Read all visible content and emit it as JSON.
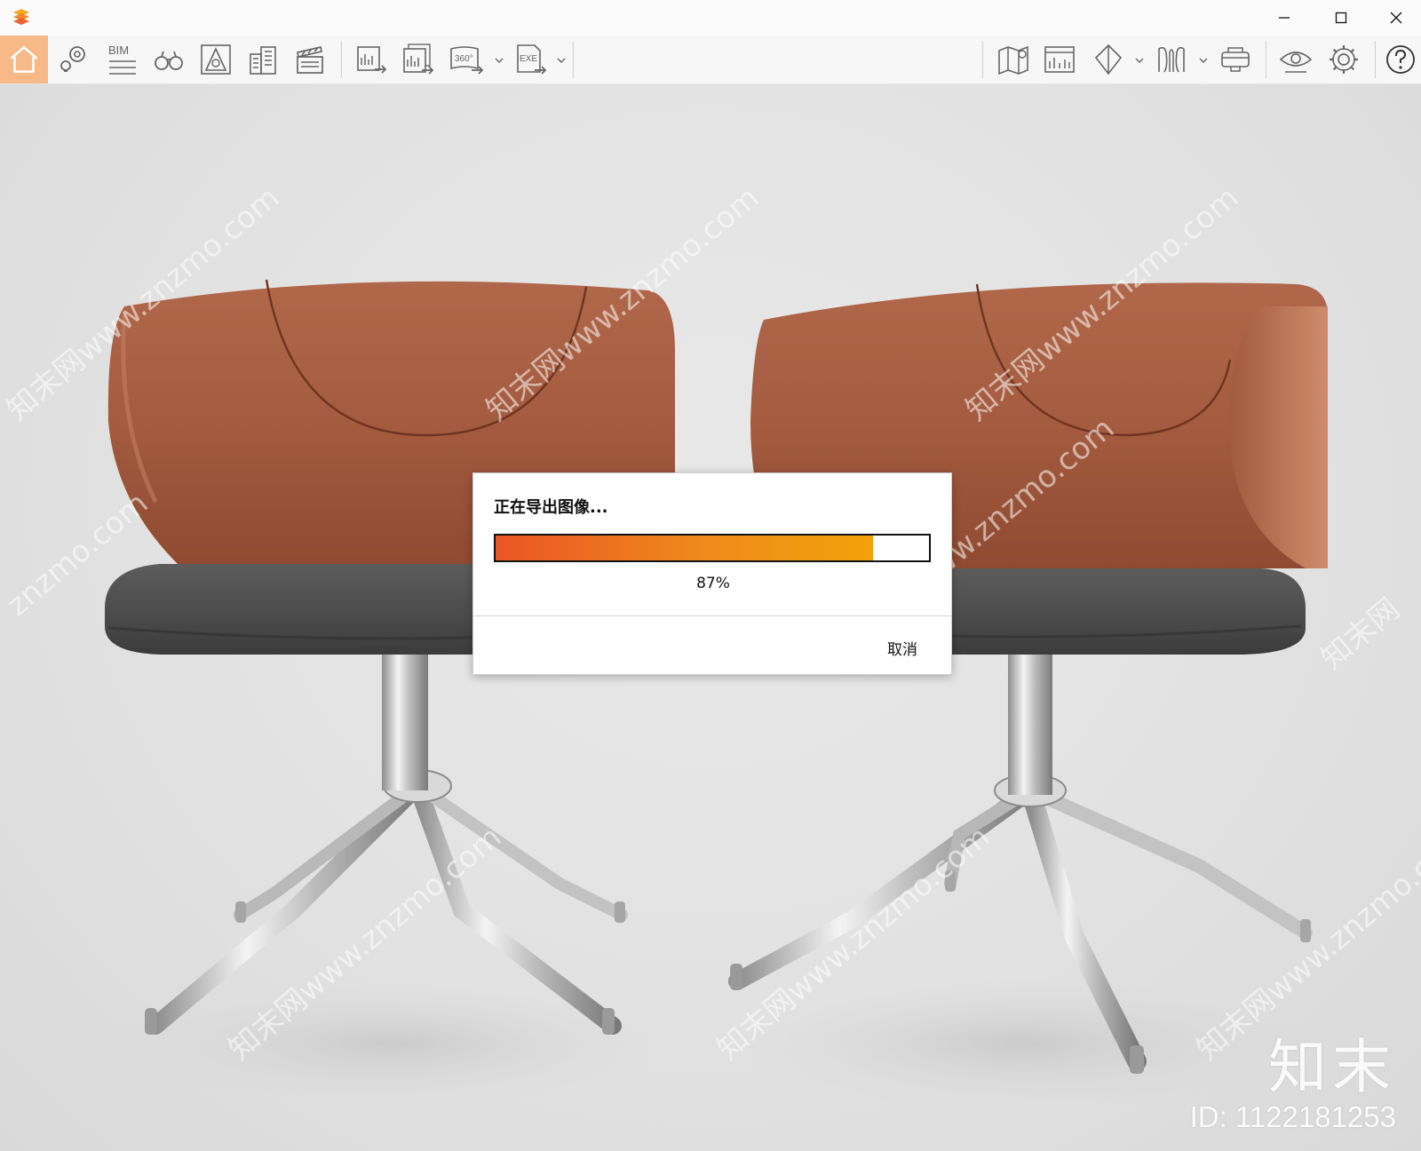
{
  "titlebar": {
    "logo_icon": "app-logo-icon",
    "controls": [
      "minimize-icon",
      "maximize-icon",
      "close-icon"
    ]
  },
  "toolbar": {
    "bim_label": "BIM",
    "panorama_label": "360°",
    "exe_label": "EXE",
    "accent_color": "#f6b987",
    "collapse_color": "#f08a1c"
  },
  "dialog": {
    "title": "正在导出图像...",
    "progress_percent": 87,
    "percent_label": "87%",
    "cancel_label": "取消"
  },
  "watermark": {
    "logo_text": "知末",
    "id_text": "ID: 1122181253"
  }
}
